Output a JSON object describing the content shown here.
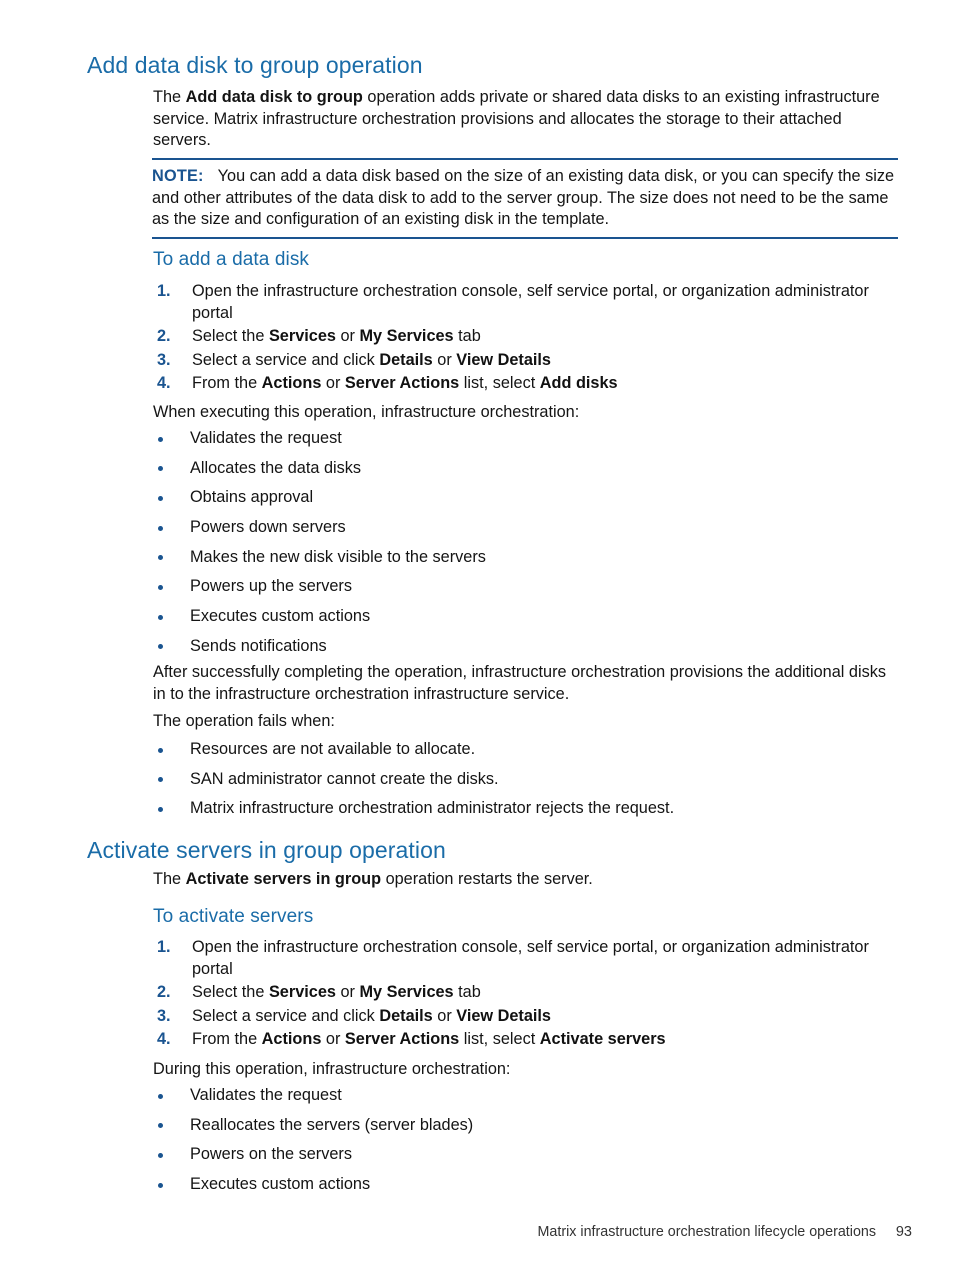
{
  "page": {
    "number": "93",
    "footer_text": "Matrix infrastructure orchestration lifecycle operations"
  },
  "sections": [
    {
      "heading": "Add data disk to group operation",
      "intro_lead": "The ",
      "intro_bold": "Add data disk to group",
      "intro_rest": " operation adds private or shared data disks to an existing infrastructure service. Matrix infrastructure orchestration provisions and allocates the storage to their attached servers.",
      "note": {
        "label": "NOTE:",
        "text": "You can add a data disk based on the size of an existing data disk, or you can specify the size and other attributes of the data disk to add to the server group. The size does not need to be the same as the size and configuration of an existing disk in the template."
      },
      "subheading": "To add a data disk",
      "steps": [
        {
          "num": "1.",
          "pre": "Open the infrastructure orchestration console, self service portal, or organization administrator portal",
          "b1": "",
          "mid": "",
          "b2": "",
          "post": "",
          "b3": "",
          "tail": ""
        },
        {
          "num": "2.",
          "pre": "Select the ",
          "b1": "Services",
          "mid": " or ",
          "b2": "My Services",
          "post": " tab",
          "b3": "",
          "tail": ""
        },
        {
          "num": "3.",
          "pre": "Select a service and click ",
          "b1": "Details",
          "mid": " or ",
          "b2": "View Details",
          "post": "",
          "b3": "",
          "tail": ""
        },
        {
          "num": "4.",
          "pre": "From the ",
          "b1": "Actions",
          "mid": " or ",
          "b2": "Server Actions",
          "post": " list, select ",
          "b3": "Add disks",
          "tail": ""
        }
      ],
      "list_intro": "When executing this operation, infrastructure orchestration:",
      "bullets": [
        "Validates the request",
        "Allocates the data disks",
        "Obtains approval",
        "Powers down servers",
        "Makes the new disk visible to the servers",
        "Powers up the servers",
        "Executes custom actions",
        "Sends notifications"
      ],
      "after_para": "After successfully completing the operation, infrastructure orchestration provisions the additional disks in to the infrastructure orchestration infrastructure service.",
      "fail_intro": "The operation fails when:",
      "fail_bullets": [
        "Resources are not available to allocate.",
        "SAN administrator cannot create the disks.",
        "Matrix infrastructure orchestration administrator rejects the request."
      ]
    },
    {
      "heading": "Activate servers in group operation",
      "intro_lead": "The ",
      "intro_bold": "Activate servers in group",
      "intro_rest": " operation restarts the server.",
      "subheading": "To activate servers",
      "steps": [
        {
          "num": "1.",
          "pre": "Open the infrastructure orchestration console, self service portal, or organization administrator portal",
          "b1": "",
          "mid": "",
          "b2": "",
          "post": "",
          "b3": "",
          "tail": ""
        },
        {
          "num": "2.",
          "pre": "Select the ",
          "b1": "Services",
          "mid": " or ",
          "b2": "My Services",
          "post": " tab",
          "b3": "",
          "tail": ""
        },
        {
          "num": "3.",
          "pre": "Select a service and click ",
          "b1": "Details",
          "mid": " or ",
          "b2": "View Details",
          "post": "",
          "b3": "",
          "tail": ""
        },
        {
          "num": "4.",
          "pre": "From the ",
          "b1": "Actions",
          "mid": " or ",
          "b2": "Server Actions",
          "post": " list, select ",
          "b3": "Activate servers",
          "tail": ""
        }
      ],
      "list_intro": "During this operation, infrastructure orchestration:",
      "bullets": [
        "Validates the request",
        "Reallocates the servers (server blades)",
        "Powers on the servers",
        "Executes custom actions"
      ]
    }
  ],
  "colors": {
    "heading_blue": "#1a6ca8",
    "accent_blue": "#1a5490",
    "body_text": "#141414"
  }
}
